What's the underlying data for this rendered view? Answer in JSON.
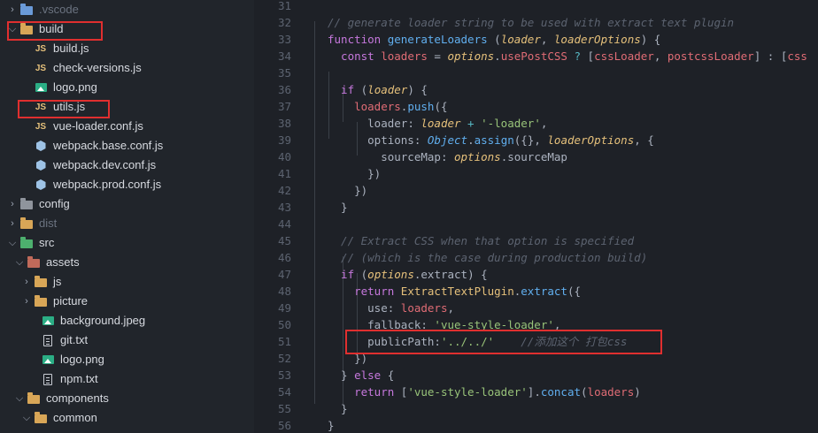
{
  "explorer": {
    "rows": [
      {
        "name": "vscode-folder",
        "label": ".vscode",
        "kind": "folder-blue",
        "chevron": "›",
        "dim": true
      },
      {
        "name": "build-folder",
        "label": "build",
        "kind": "folder",
        "chevron": "⌄"
      },
      {
        "name": "file-build-js",
        "label": "build.js",
        "kind": "js"
      },
      {
        "name": "file-check-versions-js",
        "label": "check-versions.js",
        "kind": "js"
      },
      {
        "name": "file-logo-png",
        "label": "logo.png",
        "kind": "img"
      },
      {
        "name": "file-utils-js",
        "label": "utils.js",
        "kind": "js",
        "selected": true
      },
      {
        "name": "file-vue-loader-conf-js",
        "label": "vue-loader.conf.js",
        "kind": "js"
      },
      {
        "name": "file-webpack-base-conf-js",
        "label": "webpack.base.conf.js",
        "kind": "hex"
      },
      {
        "name": "file-webpack-dev-conf-js",
        "label": "webpack.dev.conf.js",
        "kind": "hex"
      },
      {
        "name": "file-webpack-prod-conf-js",
        "label": "webpack.prod.conf.js",
        "kind": "hex"
      },
      {
        "name": "config-folder",
        "label": "config",
        "kind": "folder-gray",
        "chevron": "›"
      },
      {
        "name": "dist-folder",
        "label": "dist",
        "kind": "folder",
        "chevron": "›",
        "dim": true
      },
      {
        "name": "src-folder",
        "label": "src",
        "kind": "folder-green",
        "chevron": "⌄"
      },
      {
        "name": "assets-folder",
        "label": "assets",
        "kind": "folder-red",
        "chevron": "⌄"
      },
      {
        "name": "js-folder",
        "label": "js",
        "kind": "folder",
        "chevron": "›"
      },
      {
        "name": "picture-folder",
        "label": "picture",
        "kind": "folder",
        "chevron": "›"
      },
      {
        "name": "file-background-jpeg",
        "label": "background.jpeg",
        "kind": "img"
      },
      {
        "name": "file-git-txt",
        "label": "git.txt",
        "kind": "txt"
      },
      {
        "name": "file-logo-png-assets",
        "label": "logo.png",
        "kind": "img"
      },
      {
        "name": "file-npm-txt",
        "label": "npm.txt",
        "kind": "txt"
      },
      {
        "name": "components-folder",
        "label": "components",
        "kind": "folder",
        "chevron": "⌄"
      },
      {
        "name": "common-folder",
        "label": "common",
        "kind": "folder",
        "chevron": "⌄"
      }
    ]
  },
  "editor": {
    "line_numbers": [
      "31",
      "32",
      "33",
      "34",
      "35",
      "36",
      "37",
      "38",
      "39",
      "40",
      "41",
      "42",
      "43",
      "44",
      "45",
      "46",
      "47",
      "48",
      "49",
      "50",
      "51",
      "52",
      "53",
      "54",
      "55",
      "56"
    ],
    "lines": [
      [],
      [
        {
          "t": "// generate loader string to be used with extract text plugin",
          "c": "cm"
        }
      ],
      [
        {
          "t": "function ",
          "c": "kw"
        },
        {
          "t": "generateLoaders ",
          "c": "fn"
        },
        {
          "t": "(",
          "c": "plain"
        },
        {
          "t": "loader",
          "c": "param"
        },
        {
          "t": ", ",
          "c": "plain"
        },
        {
          "t": "loaderOptions",
          "c": "param"
        },
        {
          "t": ") {",
          "c": "plain"
        }
      ],
      [
        {
          "t": "  const ",
          "c": "kw"
        },
        {
          "t": "loaders",
          "c": "var"
        },
        {
          "t": " = ",
          "c": "plain"
        },
        {
          "t": "options",
          "c": "param"
        },
        {
          "t": ".",
          "c": "plain"
        },
        {
          "t": "usePostCSS",
          "c": "var"
        },
        {
          "t": " ? ",
          "c": "op"
        },
        {
          "t": "[",
          "c": "plain"
        },
        {
          "t": "cssLoader",
          "c": "var"
        },
        {
          "t": ", ",
          "c": "plain"
        },
        {
          "t": "postcssLoader",
          "c": "var"
        },
        {
          "t": "] : [",
          "c": "plain"
        },
        {
          "t": "css",
          "c": "var"
        }
      ],
      [],
      [
        {
          "t": "  if ",
          "c": "kw"
        },
        {
          "t": "(",
          "c": "plain"
        },
        {
          "t": "loader",
          "c": "param"
        },
        {
          "t": ") {",
          "c": "plain"
        }
      ],
      [
        {
          "t": "    loaders",
          "c": "var"
        },
        {
          "t": ".",
          "c": "plain"
        },
        {
          "t": "push",
          "c": "fn"
        },
        {
          "t": "({",
          "c": "plain"
        }
      ],
      [
        {
          "t": "      loader",
          "c": "plain"
        },
        {
          "t": ": ",
          "c": "plain"
        },
        {
          "t": "loader",
          "c": "param"
        },
        {
          "t": " + ",
          "c": "op"
        },
        {
          "t": "'-loader'",
          "c": "str"
        },
        {
          "t": ",",
          "c": "plain"
        }
      ],
      [
        {
          "t": "      options",
          "c": "plain"
        },
        {
          "t": ": ",
          "c": "plain"
        },
        {
          "t": "Object",
          "c": "obj"
        },
        {
          "t": ".",
          "c": "plain"
        },
        {
          "t": "assign",
          "c": "fn"
        },
        {
          "t": "({}, ",
          "c": "plain"
        },
        {
          "t": "loaderOptions",
          "c": "param"
        },
        {
          "t": ", {",
          "c": "plain"
        }
      ],
      [
        {
          "t": "        sourceMap",
          "c": "plain"
        },
        {
          "t": ": ",
          "c": "plain"
        },
        {
          "t": "options",
          "c": "param"
        },
        {
          "t": ".",
          "c": "plain"
        },
        {
          "t": "sourceMap",
          "c": "plain"
        }
      ],
      [
        {
          "t": "      })",
          "c": "plain"
        }
      ],
      [
        {
          "t": "    })",
          "c": "plain"
        }
      ],
      [
        {
          "t": "  }",
          "c": "plain"
        }
      ],
      [],
      [
        {
          "t": "  // Extract CSS when that option is specified",
          "c": "cm"
        }
      ],
      [
        {
          "t": "  // (which is the case during production build)",
          "c": "cm"
        }
      ],
      [
        {
          "t": "  if ",
          "c": "kw"
        },
        {
          "t": "(",
          "c": "plain"
        },
        {
          "t": "options",
          "c": "param"
        },
        {
          "t": ".",
          "c": "plain"
        },
        {
          "t": "extract",
          "c": "plain"
        },
        {
          "t": ") {",
          "c": "plain"
        }
      ],
      [
        {
          "t": "    return ",
          "c": "kw"
        },
        {
          "t": "ExtractTextPlugin",
          "c": "cls"
        },
        {
          "t": ".",
          "c": "plain"
        },
        {
          "t": "extract",
          "c": "fn"
        },
        {
          "t": "({",
          "c": "plain"
        }
      ],
      [
        {
          "t": "      use",
          "c": "plain"
        },
        {
          "t": ": ",
          "c": "plain"
        },
        {
          "t": "loaders",
          "c": "var"
        },
        {
          "t": ",",
          "c": "plain"
        }
      ],
      [
        {
          "t": "      fallback",
          "c": "plain"
        },
        {
          "t": ": ",
          "c": "plain"
        },
        {
          "t": "'vue-style-loader'",
          "c": "str"
        },
        {
          "t": ",",
          "c": "plain"
        }
      ],
      [
        {
          "t": "      publicPath",
          "c": "plain"
        },
        {
          "t": ":",
          "c": "plain"
        },
        {
          "t": "'../../'",
          "c": "str"
        },
        {
          "t": "    //添加这个 打包css",
          "c": "cm"
        }
      ],
      [
        {
          "t": "    })",
          "c": "plain"
        }
      ],
      [
        {
          "t": "  } ",
          "c": "plain"
        },
        {
          "t": "else ",
          "c": "kw"
        },
        {
          "t": "{",
          "c": "plain"
        }
      ],
      [
        {
          "t": "    return ",
          "c": "kw"
        },
        {
          "t": "[",
          "c": "plain"
        },
        {
          "t": "'vue-style-loader'",
          "c": "str"
        },
        {
          "t": "].",
          "c": "plain"
        },
        {
          "t": "concat",
          "c": "fn"
        },
        {
          "t": "(",
          "c": "plain"
        },
        {
          "t": "loaders",
          "c": "var"
        },
        {
          "t": ")",
          "c": "plain"
        }
      ],
      [
        {
          "t": "  }",
          "c": "plain"
        }
      ],
      [
        {
          "t": "}",
          "c": "plain"
        }
      ]
    ]
  }
}
